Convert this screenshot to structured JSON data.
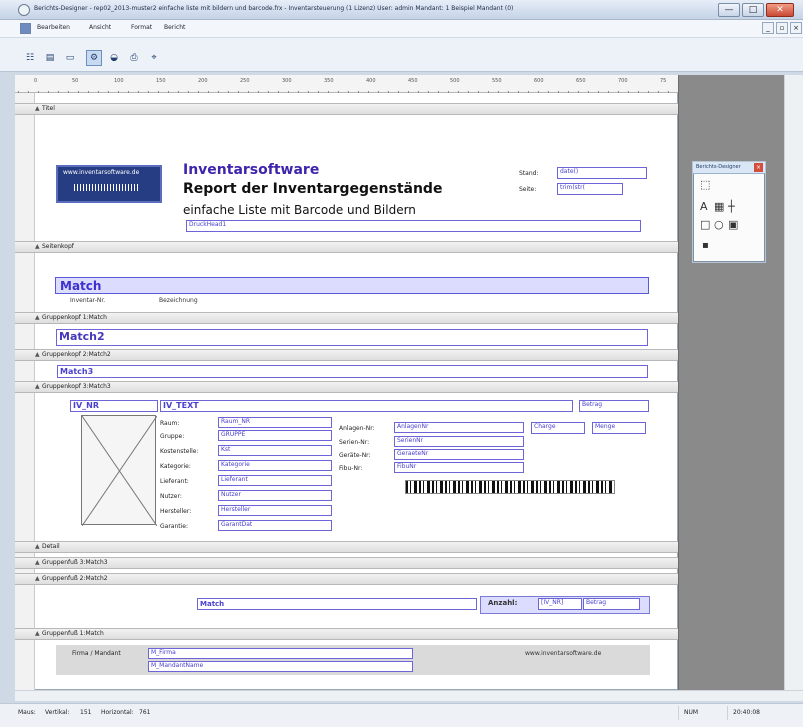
{
  "window": {
    "title": "Berichts-Designer - rep02_2013-muster2 einfache liste mit bildern und barcode.frx - Inventarsteuerung (1 Lizenz)  User: admin  Mandant: 1 Beispiel Mandant (0)",
    "min_label": "—",
    "max_label": "□",
    "close_label": "✕"
  },
  "menu": {
    "items": [
      "Bearbeiten",
      "Ansicht",
      "Format",
      "Bericht"
    ]
  },
  "ruler": {
    "marks": [
      "0",
      "50",
      "100",
      "150",
      "200",
      "250",
      "300",
      "350",
      "400",
      "450",
      "500",
      "550",
      "600",
      "650",
      "700",
      "75"
    ]
  },
  "bands": [
    {
      "label": "Titel"
    },
    {
      "label": "Seitenkopf"
    },
    {
      "label": "Gruppenkopf 1:Match"
    },
    {
      "label": "Gruppenkopf 2:Match2"
    },
    {
      "label": "Gruppenkopf 3:Match3"
    },
    {
      "label": "Detail"
    },
    {
      "label": "Gruppenfuß 3:Match3"
    },
    {
      "label": "Gruppenfuß 2:Match2"
    },
    {
      "label": "Gruppenfuß 1:Match"
    }
  ],
  "title_section": {
    "stamp_text": "www.inventarsoftware.de",
    "heading1": "Inventarsoftware",
    "heading2": "Report der Inventargegenstände",
    "heading3": "einfache Liste mit Barcode und Bildern",
    "druck_head": "DruckHead1",
    "stand_label": "Stand:",
    "stand_value": "date()",
    "seite_label": "Seite:",
    "seite_value": "trim(str("
  },
  "page_header": {
    "match": "Match",
    "inventar_label": "Inventar-Nr.",
    "bezeichnung_label": "Bezeichnung"
  },
  "group_headers": {
    "match2": "Match2",
    "match3": "Match3"
  },
  "detail": {
    "iv_nr": "IV_NR",
    "iv_text": "IV_TEXT",
    "betrag": "Betrag",
    "raum_label": "Raum:",
    "raum_value": "Raum_NR",
    "gruppe_label": "Gruppe:",
    "gruppe_value": "GRUPPE",
    "kostenstelle_label": "Kostenstelle:",
    "kostenstelle_value": "Kst",
    "kategorie_label": "Kategorie:",
    "kategorie_value": "Kategorie",
    "lieferant_label": "Lieferant:",
    "lieferant_value": "Lieferant",
    "nutzer_label": "Nutzer:",
    "nutzer_value": "Nutzer",
    "hersteller_label": "Hersteller:",
    "hersteller_value": "Hersteller",
    "garantie_label": "Garantie:",
    "garantie_value": "GarantDat",
    "anlagen_label": "Anlagen-Nr:",
    "anlagen_value": "AnlagenNr",
    "serien_label": "Serien-Nr:",
    "serien_value": "SerienNr",
    "geraete_label": "Geräte-Nr:",
    "geraete_value": "GeraeteNr",
    "fibu_label": "Fibu-Nr:",
    "fibu_value": "FibuNr",
    "charge": "Charge",
    "menge": "Menge"
  },
  "group_footer_2": {
    "match": "Match",
    "anzahl_label": "Anzahl:",
    "anzahl_value": "[IV_NR]",
    "betrag": "Betrag"
  },
  "group_footer_1": {
    "firma_label": "Firma / Mandant",
    "firma_value": "M_Firma",
    "mandant_value": "M_MandantName",
    "website": "www.inventarsoftware.de"
  },
  "toolbox": {
    "title": "Berichts-Designer"
  },
  "statusbar": {
    "mouse_label": "Maus:",
    "vertical_label": "Vertikal:",
    "vertical_value": "151",
    "horizontal_label": "Horizontal:",
    "horizontal_value": "761",
    "num": "NUM",
    "time": "20:40:08"
  }
}
